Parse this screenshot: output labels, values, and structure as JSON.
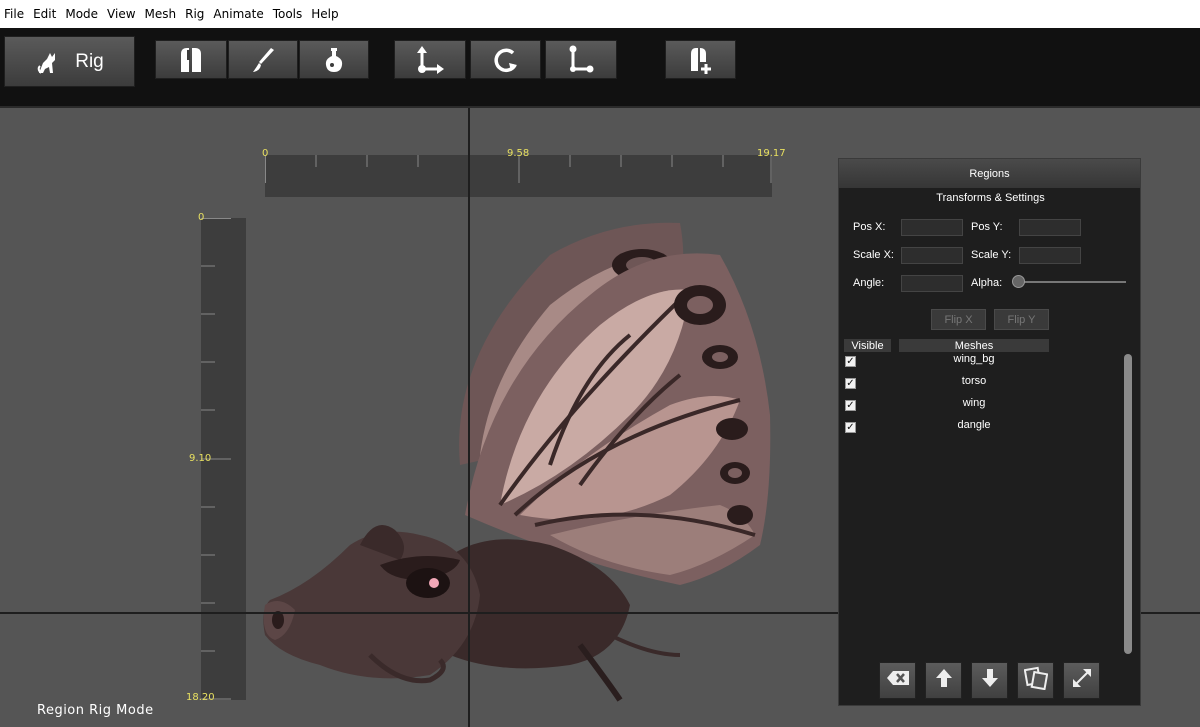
{
  "menu": [
    "File",
    "Edit",
    "Mode",
    "View",
    "Mesh",
    "Rig",
    "Animate",
    "Tools",
    "Help"
  ],
  "toolbar": {
    "rig_label": "Rig",
    "tools": [
      "bones-icon",
      "paint-brush-icon",
      "flask-icon",
      "move-axes-icon",
      "rotate-icon",
      "bone-connect-icon",
      "add-bone-icon"
    ]
  },
  "rulers": {
    "horizontal": [
      "0",
      "9.58",
      "19.17"
    ],
    "vertical": [
      "0",
      "9.10",
      "18.20"
    ],
    "label_color": "#e8e060"
  },
  "status": "Region Rig Mode",
  "panel": {
    "title": "Regions",
    "subtitle": "Transforms & Settings",
    "fields": {
      "pos_x": "Pos X:",
      "pos_y": "Pos Y:",
      "scale_x": "Scale X:",
      "scale_y": "Scale Y:",
      "angle": "Angle:",
      "alpha": "Alpha:"
    },
    "flip_x": "Flip X",
    "flip_y": "Flip Y",
    "col_visible": "Visible",
    "col_meshes": "Meshes",
    "meshes": [
      {
        "name": "wing_bg",
        "visible": true
      },
      {
        "name": "torso",
        "visible": true
      },
      {
        "name": "wing",
        "visible": true
      },
      {
        "name": "dangle",
        "visible": true
      }
    ],
    "bottom_buttons": [
      "delete-icon",
      "arrow-up-icon",
      "arrow-down-icon",
      "duplicate-icon",
      "expand-icon"
    ]
  }
}
